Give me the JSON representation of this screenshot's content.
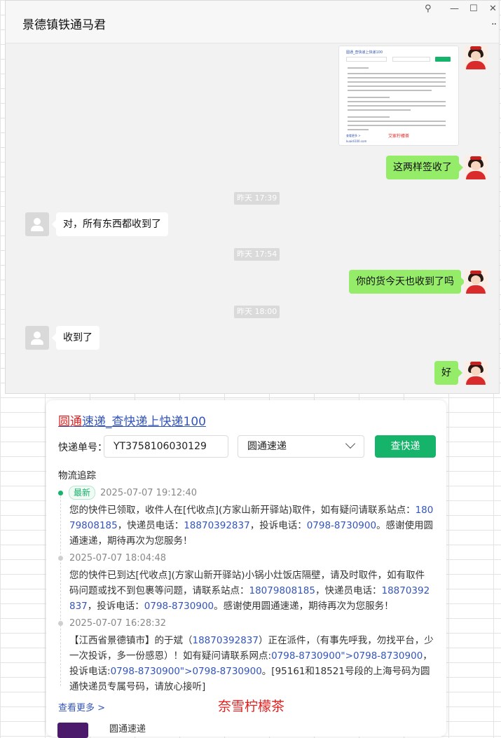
{
  "window": {
    "title": "景德镇铁通马君",
    "controls": {
      "pin": "⚲",
      "minimize": "—",
      "maximize": "☐",
      "close": "✕",
      "more": "··"
    }
  },
  "chat": {
    "screenshot_title": "圆通_查快递上快递100",
    "screenshot_footer": "查看更多 >",
    "screenshot_sign": "艾家柠檬茶",
    "screenshot_domain": "kuaidi100.com",
    "messages": [
      {
        "from": "me",
        "text": "这两样签收了"
      },
      {
        "time": "昨天 17:39"
      },
      {
        "from": "other",
        "text": "对，所有东西都收到了"
      },
      {
        "time": "昨天 17:54"
      },
      {
        "from": "me",
        "text": "你的货今天也收到了吗"
      },
      {
        "time": "昨天 18:00"
      },
      {
        "from": "other",
        "text": "收到了"
      },
      {
        "from": "me",
        "text": "好"
      }
    ]
  },
  "card": {
    "title_red": "圆通",
    "title_rest": "速递_查快递上快递100",
    "tracking_label": "快递单号：",
    "tracking_value": "YT3758106030129",
    "carrier": "圆通速递",
    "query_button": "查快递",
    "section": "物流追踪",
    "latest_tag": "最新",
    "events": [
      {
        "time": "2025-07-07 19:12:40",
        "parts": [
          "您的快件已领取，收件人在[代收点](方家山新开驿站)取件，如有疑问请联系站点：",
          "18079808185",
          "，快递员电话：",
          "18870392837",
          "，投诉电话：",
          "0798-8730900",
          "。感谢使用圆通速递，期待再次为您服务！"
        ]
      },
      {
        "time": "2025-07-07 18:04:48",
        "parts": [
          "您的快件已到达[代收点](方家山新开驿站)小锅小灶饭店隔壁，请及时取件，如有取件码问题或找不到包裹等问题，请联系站点：",
          "18079808185",
          "，快递员电话：",
          "18870392837",
          "，投诉电话：",
          "0798-8730900",
          "。感谢使用圆通速递，期待再次为您服务！"
        ]
      },
      {
        "time": "2025-07-07 16:28:32",
        "parts": [
          "【江西省景德镇市】的于斌（",
          "18870392837",
          "）正在派件，（有事先呼我，勿找平台，少一次投诉，多一份感恩）！如有疑问请联系网点:",
          "0798-8730900\">",
          "0798-8730900",
          "，投诉电话:",
          "0798-8730900\">",
          "0798-8730900",
          "。[95161和18521号段的上海号码为圆通快递员专属号码，请放心接听]"
        ]
      }
    ],
    "more": "查看更多 >",
    "signature": "奈雪柠檬茶",
    "footer_label": "圆通速递"
  }
}
